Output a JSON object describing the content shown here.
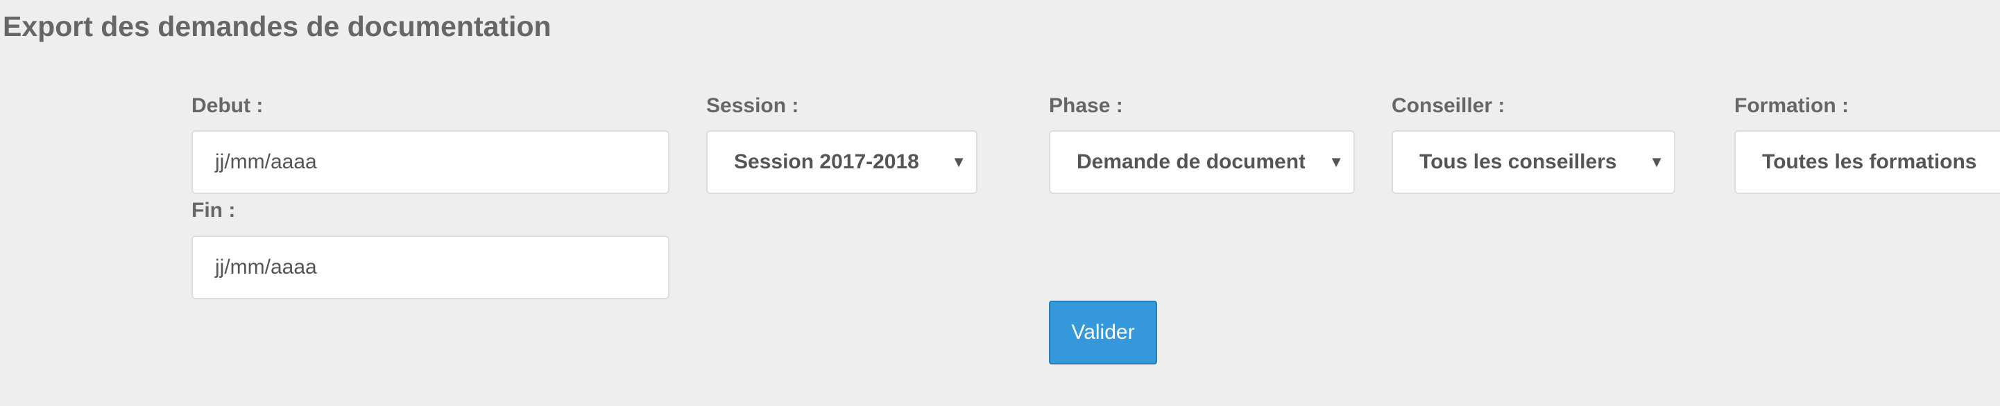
{
  "page": {
    "title": "Export des demandes de documentation"
  },
  "filters": {
    "debut": {
      "label": "Debut :",
      "placeholder": "jj/mm/aaaa"
    },
    "fin": {
      "label": "Fin :",
      "placeholder": "jj/mm/aaaa"
    },
    "session": {
      "label": "Session :",
      "selected": "Session 2017-2018"
    },
    "phase": {
      "label": "Phase :",
      "selected": "Demande de documentation"
    },
    "conseiller": {
      "label": "Conseiller :",
      "selected": "Tous les conseillers"
    },
    "formation": {
      "label": "Formation :",
      "selected": "Toutes les formations"
    }
  },
  "actions": {
    "submit_label": "Valider"
  },
  "icons": {
    "select_caret": "caret-down-icon"
  },
  "colors": {
    "background": "#eeeeee",
    "text": "#666666",
    "button": "#3498db",
    "button_text": "#ffffff"
  }
}
